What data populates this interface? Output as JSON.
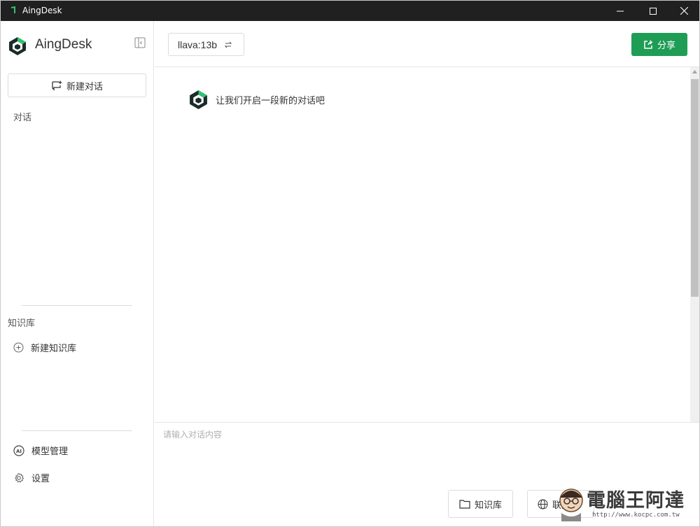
{
  "window": {
    "title": "AingDesk"
  },
  "sidebar": {
    "brand": "AingDesk",
    "new_chat_label": "新建对话",
    "conversations_label": "对话",
    "knowledge_label": "知识库",
    "new_knowledge_label": "新建知识库",
    "model_manage_label": "模型管理",
    "settings_label": "设置"
  },
  "header": {
    "model": "llava:13b",
    "share_label": "分享"
  },
  "chat": {
    "welcome": "让我们开启一段新的对话吧"
  },
  "input": {
    "placeholder": "请输入对话内容",
    "knowledge_button": "知识库",
    "web_button": "联网"
  },
  "watermark": {
    "text": "電腦王阿達",
    "url": "http://www.kocpc.com.tw"
  },
  "colors": {
    "accent": "#1f9d55",
    "titlebar": "#202020"
  },
  "icons": [
    "app-icon",
    "minimize-icon",
    "maximize-icon",
    "close-icon",
    "sidebar-collapse-icon",
    "new-chat-icon",
    "plus-circle-icon",
    "ai-icon",
    "gear-icon",
    "swap-icon",
    "share-icon",
    "folder-icon",
    "globe-icon"
  ]
}
